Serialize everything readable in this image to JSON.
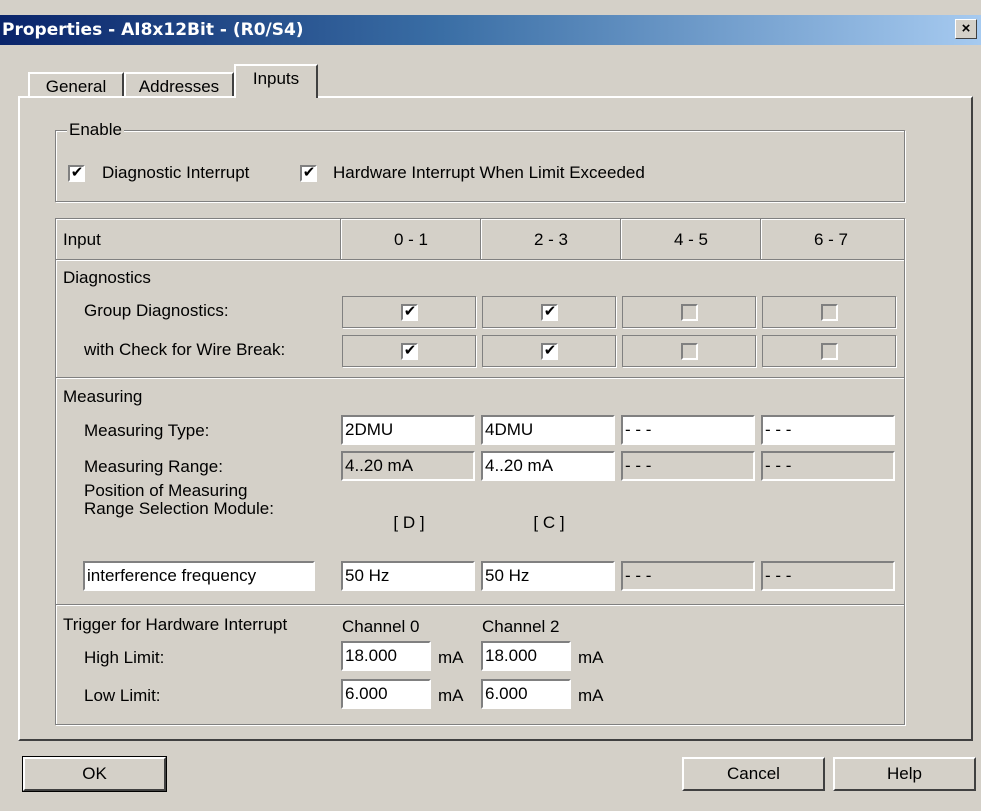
{
  "window": {
    "title": "Properties - AI8x12Bit - (R0/S4)",
    "close_glyph": "×"
  },
  "tabs": [
    {
      "label": "General",
      "active": false
    },
    {
      "label": "Addresses",
      "active": false
    },
    {
      "label": "Inputs",
      "active": true
    }
  ],
  "enable": {
    "legend": "Enable",
    "diagnostic_interrupt": {
      "label": "Diagnostic Interrupt",
      "checked": true
    },
    "hardware_interrupt": {
      "label": "Hardware Interrupt When Limit Exceeded",
      "checked": true
    }
  },
  "table": {
    "header": {
      "input_label": "Input",
      "columns": [
        "0 - 1",
        "2 - 3",
        "4 - 5",
        "6 - 7"
      ]
    },
    "diagnostics": {
      "section_label": "Diagnostics",
      "group_label": "Group Diagnostics:",
      "wire_break_label": "with Check for Wire Break:",
      "group_checked": [
        true,
        true,
        false,
        false
      ],
      "wire_break_checked": [
        true,
        true,
        false,
        false
      ],
      "enabled": [
        true,
        true,
        false,
        false
      ]
    },
    "measuring": {
      "section_label": "Measuring",
      "type_label": "Measuring Type:",
      "type_values": [
        "2DMU",
        "4DMU",
        "- - -",
        "- - -"
      ],
      "range_label": "Measuring Range:",
      "range_values": [
        "4..20 mA",
        "4..20 mA",
        "- - -",
        "- - -"
      ],
      "position_label_1": "Position of Measuring",
      "position_label_2": "Range Selection Module:",
      "position_values": [
        "[ D ]",
        "[ C ]"
      ],
      "interference_label": "interference frequency",
      "interference_values": [
        "50 Hz",
        "50 Hz",
        "- - -",
        "- - -"
      ]
    },
    "trigger": {
      "section_label": "Trigger for Hardware Interrupt",
      "channel_labels": [
        "Channel 0",
        "Channel 2"
      ],
      "high_label": "High Limit:",
      "high_values": [
        "18.000",
        "18.000"
      ],
      "low_label": "Low Limit:",
      "low_values": [
        "6.000",
        "6.000"
      ],
      "unit": "mA"
    }
  },
  "buttons": {
    "ok": "OK",
    "cancel": "Cancel",
    "help": "Help"
  },
  "check_glyph": "✔"
}
